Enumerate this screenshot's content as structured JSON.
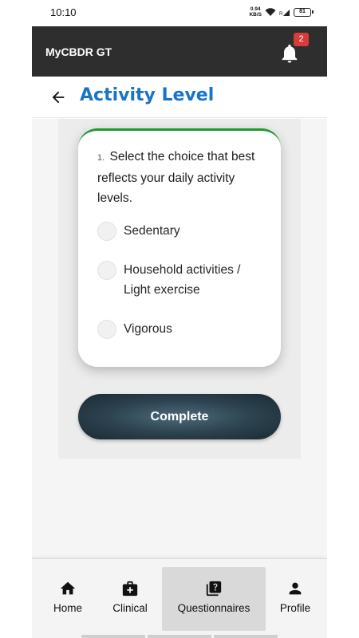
{
  "status_bar": {
    "time": "10:10",
    "net_speed_value": "0.94",
    "net_speed_unit": "KB/S",
    "battery": "81"
  },
  "app_bar": {
    "title": "MyCBDR GT",
    "notification_count": "2"
  },
  "header": {
    "title": "Activity Level"
  },
  "question": {
    "number": "1.",
    "text": "Select the choice that best reflects your daily activity levels.",
    "options": [
      {
        "label": "Sedentary"
      },
      {
        "label": "Household activities / Light exercise"
      },
      {
        "label": "Vigorous"
      }
    ]
  },
  "complete_button": {
    "label": "Complete"
  },
  "bottom_nav": {
    "items": [
      {
        "label": "Home",
        "icon": "home-icon"
      },
      {
        "label": "Clinical",
        "icon": "medical-kit-icon"
      },
      {
        "label": "Questionnaires",
        "icon": "question-copy-icon",
        "active": true
      },
      {
        "label": "Profile",
        "icon": "person-icon"
      }
    ]
  },
  "colors": {
    "app_bar": "#2e2e2e",
    "title_blue": "#1874c7",
    "card_accent": "#1f9a2e",
    "badge": "#d93a3a"
  }
}
